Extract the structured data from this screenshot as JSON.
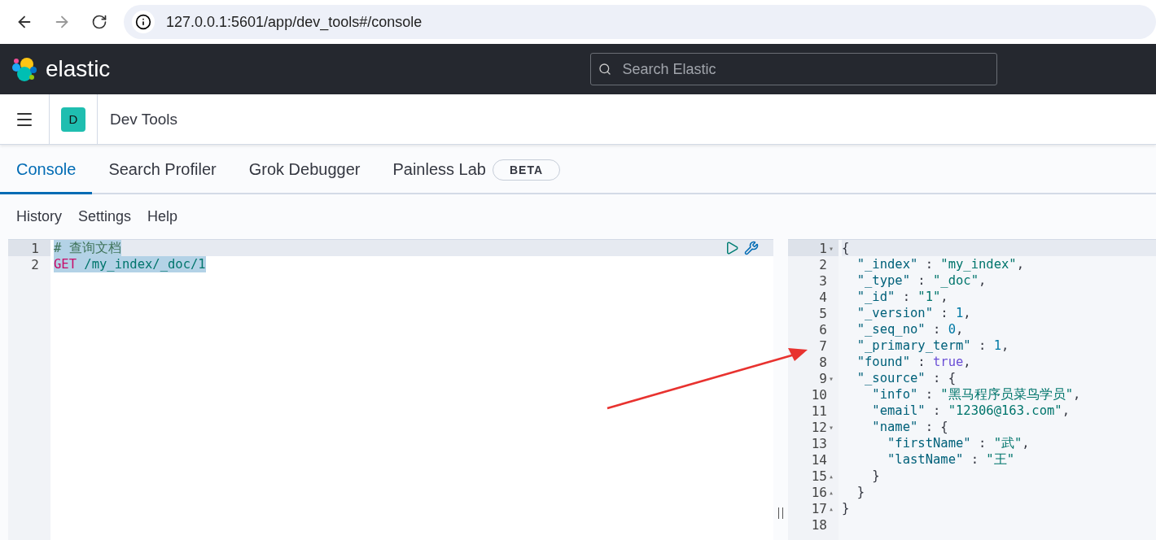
{
  "browser": {
    "url": "127.0.0.1:5601/app/dev_tools#/console"
  },
  "header": {
    "logo_text": "elastic",
    "search": {
      "placeholder": "Search Elastic"
    }
  },
  "breadcrumb": {
    "space_initial": "D",
    "title": "Dev Tools"
  },
  "tabs": [
    {
      "label": "Console",
      "selected": true
    },
    {
      "label": "Search Profiler",
      "selected": false
    },
    {
      "label": "Grok Debugger",
      "selected": false
    },
    {
      "label": "Painless Lab",
      "selected": false,
      "badge": "BETA"
    }
  ],
  "menu": [
    "History",
    "Settings",
    "Help"
  ],
  "request": {
    "lines": [
      {
        "number": "1",
        "active": true,
        "selected": true,
        "tokens": [
          {
            "kind": "comment",
            "text": "# 查询文档"
          }
        ]
      },
      {
        "number": "2",
        "active": false,
        "selected": true,
        "tokens": [
          {
            "kind": "method",
            "text": "GET"
          },
          {
            "kind": "path",
            "text": " /my_index/_doc/1"
          }
        ]
      }
    ]
  },
  "response": {
    "lines": [
      {
        "number": "1",
        "active": true,
        "fold": "▾",
        "tokens": [
          {
            "kind": "punct",
            "text": "{"
          }
        ]
      },
      {
        "number": "2",
        "active": false,
        "tokens": [
          {
            "kind": "key",
            "text": "  \"_index\""
          },
          {
            "kind": "punct",
            "text": " : "
          },
          {
            "kind": "string",
            "text": "\"my_index\""
          },
          {
            "kind": "punct",
            "text": ","
          }
        ]
      },
      {
        "number": "3",
        "active": false,
        "tokens": [
          {
            "kind": "key",
            "text": "  \"_type\""
          },
          {
            "kind": "punct",
            "text": " : "
          },
          {
            "kind": "string",
            "text": "\"_doc\""
          },
          {
            "kind": "punct",
            "text": ","
          }
        ]
      },
      {
        "number": "4",
        "active": false,
        "tokens": [
          {
            "kind": "key",
            "text": "  \"_id\""
          },
          {
            "kind": "punct",
            "text": " : "
          },
          {
            "kind": "string",
            "text": "\"1\""
          },
          {
            "kind": "punct",
            "text": ","
          }
        ]
      },
      {
        "number": "5",
        "active": false,
        "tokens": [
          {
            "kind": "key",
            "text": "  \"_version\""
          },
          {
            "kind": "punct",
            "text": " : "
          },
          {
            "kind": "number",
            "text": "1"
          },
          {
            "kind": "punct",
            "text": ","
          }
        ]
      },
      {
        "number": "6",
        "active": false,
        "tokens": [
          {
            "kind": "key",
            "text": "  \"_seq_no\""
          },
          {
            "kind": "punct",
            "text": " : "
          },
          {
            "kind": "number",
            "text": "0"
          },
          {
            "kind": "punct",
            "text": ","
          }
        ]
      },
      {
        "number": "7",
        "active": false,
        "tokens": [
          {
            "kind": "key",
            "text": "  \"_primary_term\""
          },
          {
            "kind": "punct",
            "text": " : "
          },
          {
            "kind": "number",
            "text": "1"
          },
          {
            "kind": "punct",
            "text": ","
          }
        ]
      },
      {
        "number": "8",
        "active": false,
        "tokens": [
          {
            "kind": "key",
            "text": "  \"found\""
          },
          {
            "kind": "punct",
            "text": " : "
          },
          {
            "kind": "bool",
            "text": "true"
          },
          {
            "kind": "punct",
            "text": ","
          }
        ]
      },
      {
        "number": "9",
        "active": false,
        "fold": "▾",
        "tokens": [
          {
            "kind": "key",
            "text": "  \"_source\""
          },
          {
            "kind": "punct",
            "text": " : {"
          }
        ]
      },
      {
        "number": "10",
        "active": false,
        "tokens": [
          {
            "kind": "key",
            "text": "    \"info\""
          },
          {
            "kind": "punct",
            "text": " : "
          },
          {
            "kind": "string",
            "text": "\"黑马程序员菜鸟学员\""
          },
          {
            "kind": "punct",
            "text": ","
          }
        ]
      },
      {
        "number": "11",
        "active": false,
        "tokens": [
          {
            "kind": "key",
            "text": "    \"email\""
          },
          {
            "kind": "punct",
            "text": " : "
          },
          {
            "kind": "string",
            "text": "\"12306@163.com\""
          },
          {
            "kind": "punct",
            "text": ","
          }
        ]
      },
      {
        "number": "12",
        "active": false,
        "fold": "▾",
        "tokens": [
          {
            "kind": "key",
            "text": "    \"name\""
          },
          {
            "kind": "punct",
            "text": " : {"
          }
        ]
      },
      {
        "number": "13",
        "active": false,
        "tokens": [
          {
            "kind": "key",
            "text": "      \"firstName\""
          },
          {
            "kind": "punct",
            "text": " : "
          },
          {
            "kind": "string",
            "text": "\"武\""
          },
          {
            "kind": "punct",
            "text": ","
          }
        ]
      },
      {
        "number": "14",
        "active": false,
        "tokens": [
          {
            "kind": "key",
            "text": "      \"lastName\""
          },
          {
            "kind": "punct",
            "text": " : "
          },
          {
            "kind": "string",
            "text": "\"王\""
          }
        ]
      },
      {
        "number": "15",
        "active": false,
        "fold": "▴",
        "tokens": [
          {
            "kind": "punct",
            "text": "    }"
          }
        ]
      },
      {
        "number": "16",
        "active": false,
        "fold": "▴",
        "tokens": [
          {
            "kind": "punct",
            "text": "  }"
          }
        ]
      },
      {
        "number": "17",
        "active": false,
        "fold": "▴",
        "tokens": [
          {
            "kind": "punct",
            "text": "}"
          }
        ]
      },
      {
        "number": "18",
        "active": false
      }
    ]
  }
}
